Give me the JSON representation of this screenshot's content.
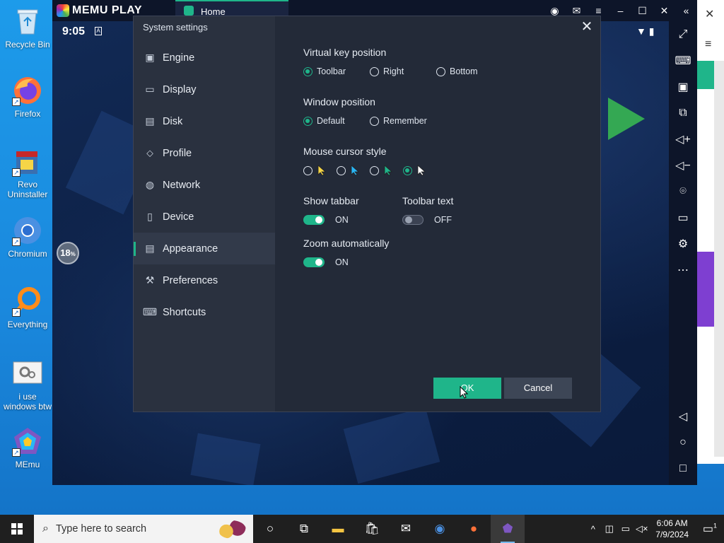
{
  "desktop": {
    "icons": [
      {
        "label": "Recycle Bin"
      },
      {
        "label": "Firefox"
      },
      {
        "label": "Revo Uninstaller"
      },
      {
        "label": "Chromium"
      },
      {
        "label": "Everything"
      },
      {
        "label": "i use windows btw"
      },
      {
        "label": "MEmu"
      }
    ]
  },
  "memu": {
    "brand": "MEMU PLAY",
    "tab_label": "Home",
    "status_time": "9:05",
    "progress_text": "18",
    "progress_unit": "%"
  },
  "dialog": {
    "title": "System settings",
    "nav": [
      {
        "label": "Engine",
        "icon": "engine-icon"
      },
      {
        "label": "Display",
        "icon": "display-icon"
      },
      {
        "label": "Disk",
        "icon": "disk-icon"
      },
      {
        "label": "Profile",
        "icon": "profile-icon"
      },
      {
        "label": "Network",
        "icon": "network-icon"
      },
      {
        "label": "Device",
        "icon": "device-icon"
      },
      {
        "label": "Appearance",
        "icon": "appearance-icon",
        "active": true
      },
      {
        "label": "Preferences",
        "icon": "preferences-icon"
      },
      {
        "label": "Shortcuts",
        "icon": "keyboard-icon"
      }
    ],
    "virtual_key": {
      "label": "Virtual key position",
      "options": [
        "Toolbar",
        "Right",
        "Bottom"
      ],
      "selected": "Toolbar"
    },
    "window_position": {
      "label": "Window position",
      "options": [
        "Default",
        "Remember"
      ],
      "selected": "Default"
    },
    "mouse_cursor": {
      "label": "Mouse cursor style",
      "options": [
        "yellow-cursor",
        "cyan-cursor",
        "teal-cursor",
        "white-cursor"
      ],
      "selected": "white-cursor",
      "colors": [
        "#f5d547",
        "#29b6f6",
        "#1fb58a",
        "#ffffff"
      ]
    },
    "show_tabbar": {
      "label": "Show tabbar",
      "state": "ON"
    },
    "toolbar_text": {
      "label": "Toolbar text",
      "state": "OFF"
    },
    "zoom_auto": {
      "label": "Zoom automatically",
      "state": "ON"
    },
    "ok_label": "OK",
    "cancel_label": "Cancel"
  },
  "taskbar": {
    "search_placeholder": "Type here to search",
    "time": "6:06 AM",
    "date": "7/9/2024",
    "notification_count": "1"
  },
  "colors": {
    "accent": "#1fb58a",
    "dialog_bg": "#232a38",
    "sidebar_bg": "#2a313f"
  }
}
